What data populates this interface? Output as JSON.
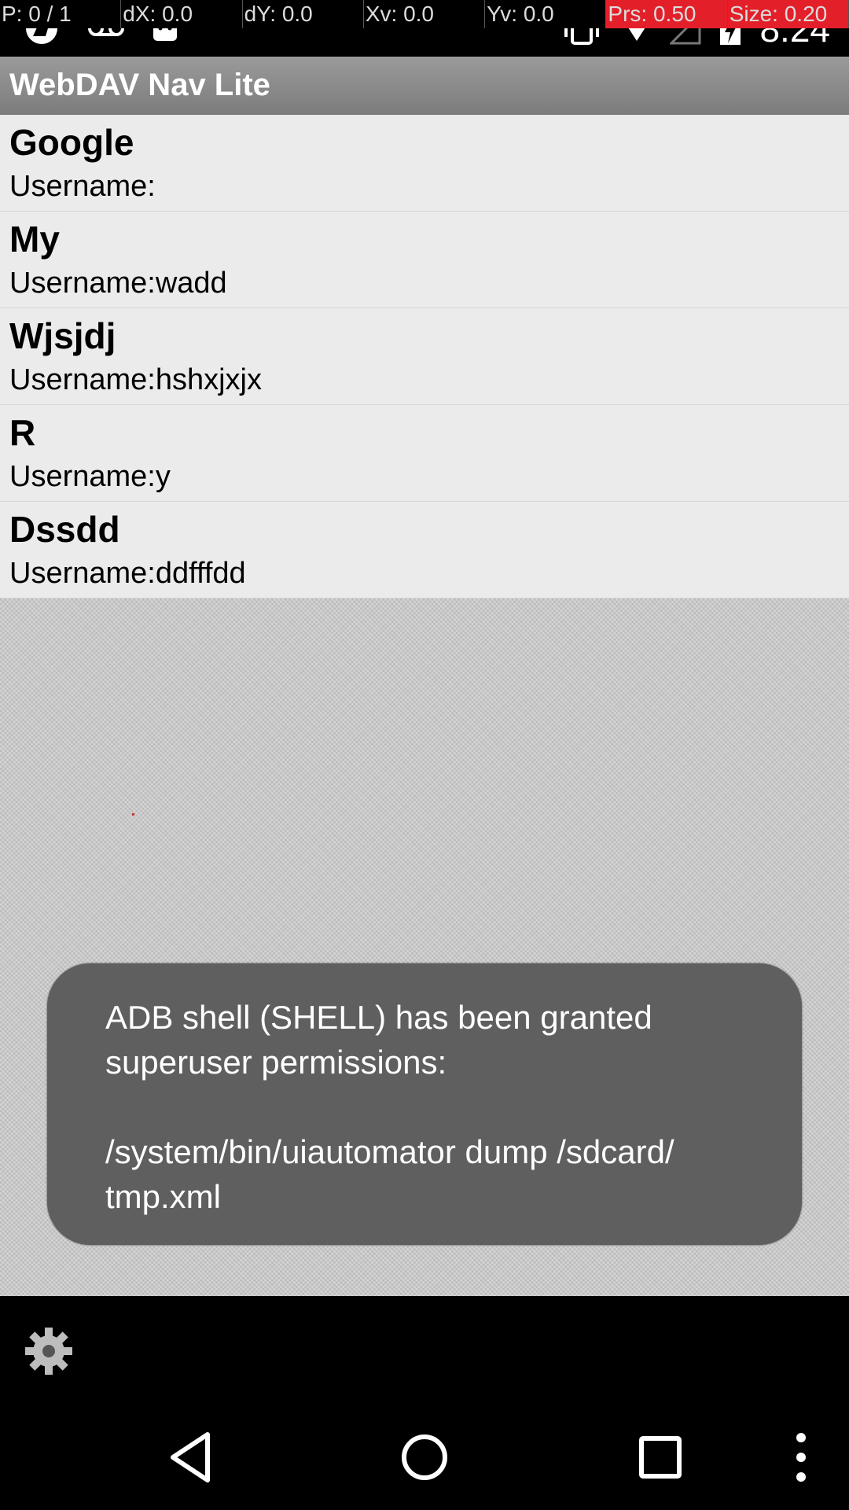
{
  "debug": {
    "pointer": "P: 0 / 1",
    "dx": "dX: 0.0",
    "dy": "dY: 0.0",
    "xv": "Xv: 0.0",
    "yv": "Yv: 0.0",
    "prs": "Prs: 0.50",
    "size": "Size: 0.20"
  },
  "status_bar": {
    "time": "8:24",
    "icons_left": [
      "app-notification-icon",
      "voicemail-icon",
      "android-icon"
    ],
    "icons_right": [
      "vibrate-icon",
      "wifi-icon",
      "signal-icon",
      "battery-charging-icon"
    ]
  },
  "app_bar": {
    "title": "WebDAV Nav Lite"
  },
  "servers": [
    {
      "name": "Google",
      "username": "Username:"
    },
    {
      "name": "My",
      "username": "Username:wadd"
    },
    {
      "name": "Wjsjdj",
      "username": "Username:hshxjxjx"
    },
    {
      "name": "R",
      "username": "Username:y"
    },
    {
      "name": "Dssdd",
      "username": "Username:ddfffdd"
    }
  ],
  "toast": {
    "message": "ADB shell (SHELL) has been granted\nsuperuser permissions:\n\n/system/bin/uiautomator dump /sdcard/\ntmp.xml"
  },
  "bottom": {
    "settings_icon": "gear-icon"
  },
  "nav": {
    "back": "back-icon",
    "home": "home-icon",
    "recents": "recents-icon",
    "menu": "overflow-menu-icon"
  },
  "colors": {
    "accent_alert": "#e3202a",
    "app_bar": "#8a8a8a",
    "toast_bg": "#5f5f5f"
  }
}
